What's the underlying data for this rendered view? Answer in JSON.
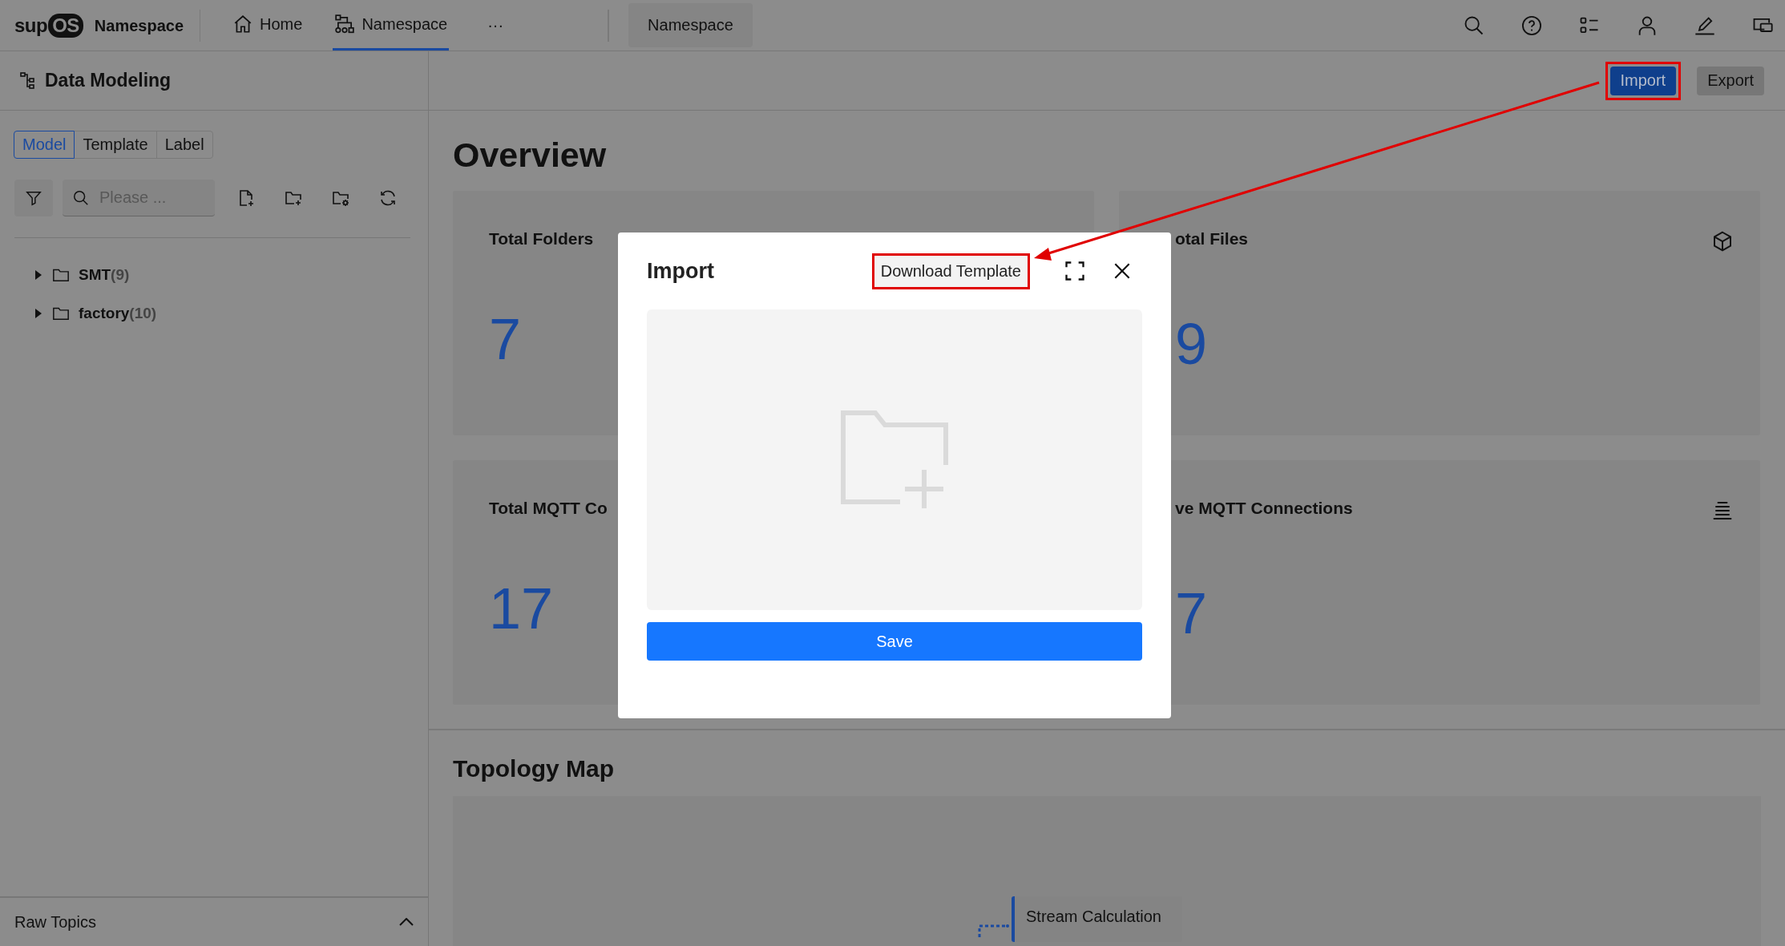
{
  "top_bar": {
    "logo": {
      "text": "sup",
      "badge": "OS"
    },
    "app_title": "Namespace",
    "nav_tabs": [
      {
        "label": "Home",
        "kind": "home",
        "selected": false
      },
      {
        "label": "Namespace",
        "kind": "namespace",
        "selected": true
      }
    ],
    "more": "···",
    "open_tabs": [
      {
        "label": "Namespace"
      }
    ],
    "actions": [
      {
        "kind": "search"
      },
      {
        "kind": "help"
      },
      {
        "kind": "list"
      },
      {
        "kind": "user"
      },
      {
        "kind": "edit"
      },
      {
        "kind": "windows"
      }
    ]
  },
  "sidebar": {
    "title": "Data Modeling",
    "segments": [
      {
        "label": "Model",
        "selected": true
      },
      {
        "label": "Template",
        "selected": false
      },
      {
        "label": "Label",
        "selected": false
      }
    ],
    "search": {
      "placeholder": "Please ..."
    },
    "tools": [
      {
        "kind": "file-add"
      },
      {
        "kind": "folder-add"
      },
      {
        "kind": "folder-settings"
      },
      {
        "kind": "refresh"
      }
    ],
    "tree": [
      {
        "name": "SMT",
        "count": "(9)",
        "expanded": false
      },
      {
        "name": "factory",
        "count": "(10)",
        "expanded": false
      }
    ],
    "footer": {
      "label": "Raw Topics",
      "expanded": false
    }
  },
  "toolbar": {
    "buttons": [
      {
        "label": "Import",
        "kind": "primary",
        "highlighted": true
      },
      {
        "label": "Export",
        "kind": "default",
        "highlighted": false
      }
    ]
  },
  "overview": {
    "title": "Overview",
    "cards": [
      {
        "title": "Total Folders",
        "value": "7"
      },
      {
        "title": "otal Files",
        "value": "9"
      },
      {
        "title": "Total MQTT Co",
        "value": "17"
      },
      {
        "title": "ve MQTT Connections",
        "value": "7"
      }
    ]
  },
  "topology": {
    "title": "Topology Map",
    "nodes": [
      {
        "label": "Stream Calculation"
      }
    ]
  },
  "dialog": {
    "title": "Import",
    "download": {
      "label": "Download Template",
      "highlighted": true
    },
    "save": "Save"
  }
}
